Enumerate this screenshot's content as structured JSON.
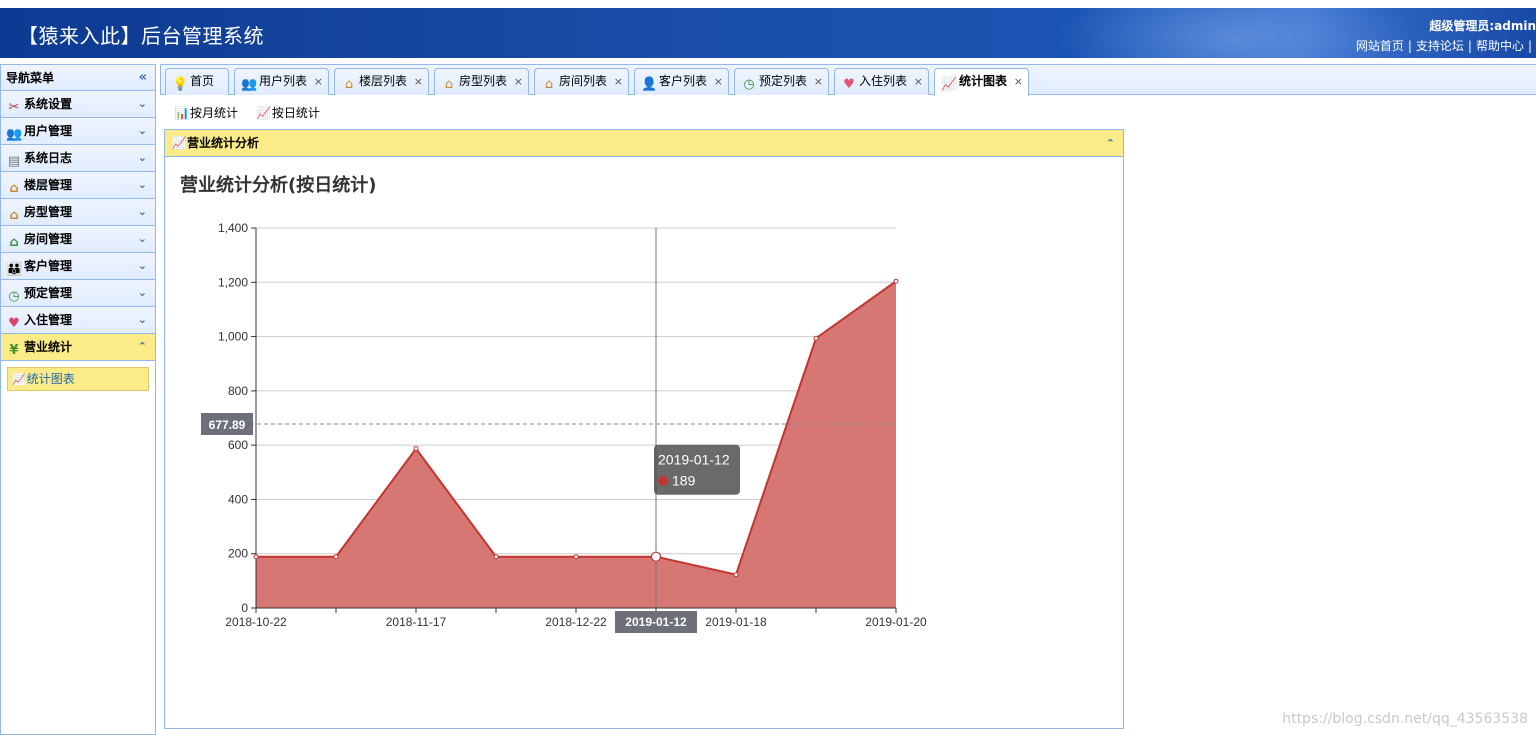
{
  "header": {
    "title": "【猿来入此】后台管理系统",
    "admin_label": "超级管理员:admin",
    "links": [
      "网站首页",
      "支持论坛",
      "帮助中心"
    ]
  },
  "nav": {
    "title": "导航菜单",
    "menu": [
      {
        "label": "系统设置",
        "icon": "tools-icon"
      },
      {
        "label": "用户管理",
        "icon": "users-icon"
      },
      {
        "label": "系统日志",
        "icon": "log-icon"
      },
      {
        "label": "楼层管理",
        "icon": "house-icon"
      },
      {
        "label": "房型管理",
        "icon": "house-icon"
      },
      {
        "label": "房间管理",
        "icon": "house-green-icon"
      },
      {
        "label": "客户管理",
        "icon": "customers-icon"
      },
      {
        "label": "预定管理",
        "icon": "clock-icon"
      },
      {
        "label": "入住管理",
        "icon": "heart-icon"
      },
      {
        "label": "营业统计",
        "icon": "yen-icon"
      }
    ],
    "active_submenu": "统计图表"
  },
  "tabs": [
    {
      "label": "首页",
      "icon": "bulb-icon",
      "closable": false
    },
    {
      "label": "用户列表",
      "icon": "users-icon",
      "closable": true
    },
    {
      "label": "楼层列表",
      "icon": "house-icon",
      "closable": true
    },
    {
      "label": "房型列表",
      "icon": "house-icon",
      "closable": true
    },
    {
      "label": "房间列表",
      "icon": "house-icon",
      "closable": true
    },
    {
      "label": "客户列表",
      "icon": "customer-icon",
      "closable": true
    },
    {
      "label": "预定列表",
      "icon": "clock-icon",
      "closable": true
    },
    {
      "label": "入住列表",
      "icon": "heart-icon",
      "closable": true
    },
    {
      "label": "统计图表",
      "icon": "chart-icon",
      "closable": true,
      "selected": true
    }
  ],
  "toolbar": {
    "monthly": "按月统计",
    "daily": "按日统计"
  },
  "panel": {
    "title": "营业统计分析"
  },
  "tooltip": {
    "date": "2019-01-12",
    "value": "189",
    "axis_pointer_y": "677.89",
    "axis_pointer_x": "2019-01-12"
  },
  "watermark": "https://blog.csdn.net/qq_43563538",
  "colors": {
    "header_blue": "#1a4ea8",
    "active_yellow": "#fbec88",
    "series_red": "#c23531",
    "area_fill": "#d4706c"
  },
  "chart_data": {
    "type": "area",
    "title": "营业统计分析(按日统计)",
    "x": [
      "2018-10-22",
      "2018-11-17",
      "2018-11-17",
      "2018-12-22",
      "2018-12-22",
      "2019-01-12",
      "2019-01-18",
      "2019-01-18",
      "2019-01-20"
    ],
    "x_tick_labels": [
      "2018-10-22",
      "2018-11-17",
      "2018-12-22",
      "2019-01-12",
      "2019-01-18",
      "2019-01-20"
    ],
    "values": [
      189,
      189,
      587,
      189,
      189,
      189,
      123,
      994,
      1204
    ],
    "ylim": [
      0,
      1400
    ],
    "y_ticks": [
      "0",
      "200",
      "400",
      "600",
      "800",
      "1,000",
      "1,200",
      "1,400"
    ],
    "grid": true
  }
}
